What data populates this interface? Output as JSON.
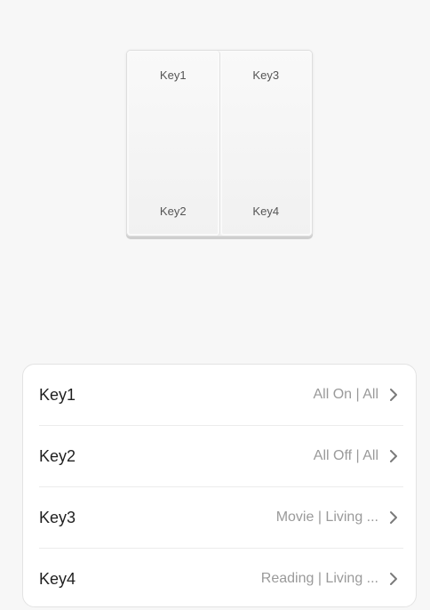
{
  "panel": {
    "top_left": "Key1",
    "bottom_left": "Key2",
    "top_right": "Key3",
    "bottom_right": "Key4"
  },
  "keys": [
    {
      "label": "Key1",
      "value": "All On | All",
      "icon": "chevron-right-icon"
    },
    {
      "label": "Key2",
      "value": "All Off | All",
      "icon": "chevron-right-icon"
    },
    {
      "label": "Key3",
      "value": "Movie | Living ...",
      "icon": "chevron-right-icon"
    },
    {
      "label": "Key4",
      "value": "Reading | Living ...",
      "icon": "chevron-right-icon"
    }
  ],
  "colors": {
    "background": "#f7f7f7",
    "card": "#ffffff",
    "label": "#1f1f1f",
    "value": "#9a9a9a",
    "chevron": "#7a7a7a"
  }
}
